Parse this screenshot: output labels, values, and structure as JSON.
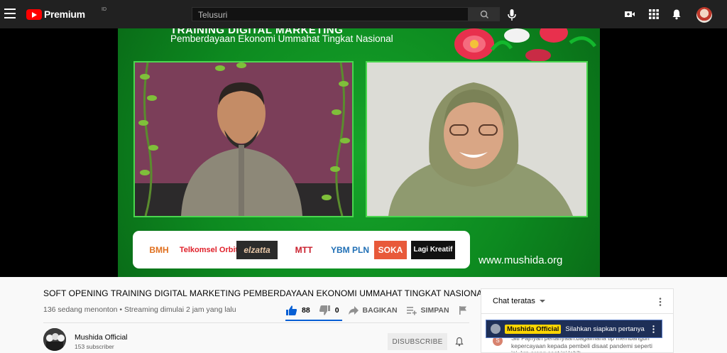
{
  "header": {
    "logo_text": "Premium",
    "logo_country": "ID",
    "search_placeholder": "Telusuri",
    "icons": [
      "menu-icon",
      "search-icon",
      "mic-icon",
      "create-video-icon",
      "apps-icon",
      "notifications-icon"
    ]
  },
  "video_frame": {
    "title": "TRAINING DIGITAL MARKETING",
    "subtitle": "Pemberdayaan Ekonomi Ummahat Tingkat Nasional",
    "url": "www.mushida.org",
    "sponsors": [
      "BMH",
      "Telkomsel Orbit",
      "elzatta",
      "MTT",
      "YBM PLN",
      "SOKA",
      "Lagi Kreatif"
    ]
  },
  "video": {
    "title": "SOFT OPENING TRAINING DIGITAL MARKETING PEMBERDAYAAN EKONOMI UMMAHAT TINGKAT NASIONAL",
    "meta": "136 sedang menonton • Streaming dimulai 2 jam yang lalu",
    "likes": "88",
    "dislikes": "0",
    "share_label": "BAGIKAN",
    "save_label": "SIMPAN",
    "like_ratio": 1.0
  },
  "channel": {
    "name": "Mushida Official",
    "subscribers": "153 subscriber",
    "unsubscribe_label": "DISUBSCRIBE"
  },
  "chat": {
    "header": "Chat teratas",
    "pinned": {
      "author": "Mushida Official",
      "message": "Silahkan siapkan pertanyaan"
    },
    "message": {
      "avatar_letter": "S",
      "text": "Siti Fajriyah  pertanyaan:bagaimana tip membangun kepercayaan kepada pembeli disaat pandemi seperti ini, krn orang saat ini lebih"
    }
  },
  "colors": {
    "topbar": "#212121",
    "youtube_red": "#ff0000",
    "frame_green": "#0d8a20",
    "accent_blue": "#065fd4",
    "chat_pinned_bg": "#1e2f57",
    "owner_badge": "#ffd600"
  }
}
